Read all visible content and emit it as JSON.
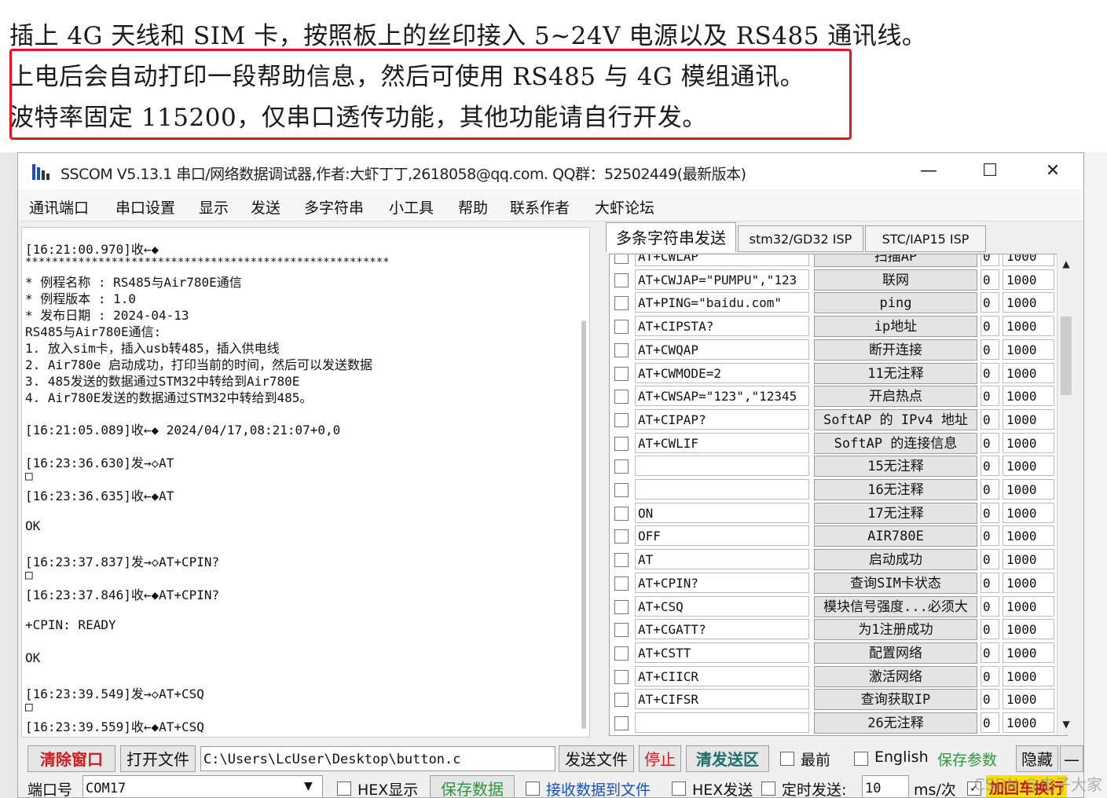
{
  "document": {
    "line1": "插上 4G 天线和 SIM 卡，按照板上的丝印接入 5~24V 电源以及 RS485 通讯线。",
    "line2": "上电后会自动打印一段帮助信息，然后可使用 RS485 与 4G 模组通讯。",
    "line3": "波特率固定 115200，仅串口透传功能，其他功能请自行开发。"
  },
  "window": {
    "title": "SSCOM V5.13.1 串口/网络数据调试器,作者:大虾丁丁,2618058@qq.com. QQ群：52502449(最新版本)",
    "minimize": "—",
    "maximize": "☐",
    "close": "✕"
  },
  "menu": [
    "通讯端口",
    "串口设置",
    "显示",
    "发送",
    "多字符串",
    "小工具",
    "帮助",
    "联系作者",
    "大虾论坛"
  ],
  "log": [
    "[16:21:00.970]收←◆",
    "*******************************************************",
    "*  例程名称    : RS485与Air780E通信",
    "*  例程版本    : 1.0",
    "*  发布日期    : 2024-04-13",
    "RS485与Air780E通信:",
    "1. 放入sim卡，插入usb转485，插入供电线",
    "2. Air780e 启动成功，打印当前的时间，然后可以发送数据",
    "3. 485发送的数据通过STM32中转给到Air780E",
    "4. Air780E发送的数据通过STM32中转给到485。",
    "[16:21:05.089]收←◆ 2024/04/17,08:21:07+0,0",
    "[16:23:36.630]发→◇AT",
    "□",
    "[16:23:36.635]收←◆AT",
    "OK",
    "[16:23:37.837]发→◇AT+CPIN?",
    "□",
    "[16:23:37.846]收←◆AT+CPIN?",
    "+CPIN: READY",
    "OK",
    "[16:23:39.549]发→◇AT+CSQ",
    "□",
    "[16:23:39.559]收←◆AT+CSQ"
  ],
  "tabs": [
    "多条字符串发送",
    "stm32/GD32 ISP",
    "STC/IAP15 ISP"
  ],
  "rows": [
    {
      "cmd": "AT+CWLAP",
      "btn": "扫描AP",
      "num": "0",
      "delay": "1000"
    },
    {
      "cmd": "AT+CWJAP=\"PUMPU\",\"123",
      "btn": "联网",
      "num": "0",
      "delay": "1000"
    },
    {
      "cmd": "AT+PING=\"baidu.com\"",
      "btn": "ping",
      "num": "0",
      "delay": "1000"
    },
    {
      "cmd": "AT+CIPSTA?",
      "btn": "ip地址",
      "num": "0",
      "delay": "1000"
    },
    {
      "cmd": "AT+CWQAP",
      "btn": "断开连接",
      "num": "0",
      "delay": "1000"
    },
    {
      "cmd": "AT+CWMODE=2",
      "btn": "11无注释",
      "num": "0",
      "delay": "1000"
    },
    {
      "cmd": "AT+CWSAP=\"123\",\"12345",
      "btn": "开启热点",
      "num": "0",
      "delay": "1000"
    },
    {
      "cmd": "AT+CIPAP?",
      "btn": "SoftAP 的 IPv4 地址",
      "num": "0",
      "delay": "1000"
    },
    {
      "cmd": "AT+CWLIF",
      "btn": "SoftAP 的连接信息",
      "num": "0",
      "delay": "1000"
    },
    {
      "cmd": "",
      "btn": "15无注释",
      "num": "0",
      "delay": "1000"
    },
    {
      "cmd": "",
      "btn": "16无注释",
      "num": "0",
      "delay": "1000"
    },
    {
      "cmd": "ON",
      "btn": "17无注释",
      "num": "0",
      "delay": "1000"
    },
    {
      "cmd": "OFF",
      "btn": "AIR780E",
      "num": "0",
      "delay": "1000"
    },
    {
      "cmd": "AT",
      "btn": "启动成功",
      "num": "0",
      "delay": "1000"
    },
    {
      "cmd": "AT+CPIN?",
      "btn": "查询SIM卡状态",
      "num": "0",
      "delay": "1000"
    },
    {
      "cmd": "AT+CSQ",
      "btn": "模块信号强度...必须大",
      "num": "0",
      "delay": "1000"
    },
    {
      "cmd": "AT+CGATT?",
      "btn": "为1注册成功",
      "num": "0",
      "delay": "1000"
    },
    {
      "cmd": "AT+CSTT",
      "btn": "配置网络",
      "num": "0",
      "delay": "1000"
    },
    {
      "cmd": "AT+CIICR",
      "btn": "激活网络",
      "num": "0",
      "delay": "1000"
    },
    {
      "cmd": "AT+CIFSR",
      "btn": "查询获取IP",
      "num": "0",
      "delay": "1000"
    },
    {
      "cmd": "",
      "btn": "26无注释",
      "num": "0",
      "delay": "1000"
    }
  ],
  "bottom": {
    "clear": "清除窗口",
    "open_file": "打开文件",
    "file_path": "C:\\Users\\LcUser\\Desktop\\button.c",
    "send_file": "发送文件",
    "stop": "停止",
    "clear_send": "清发送区",
    "topmost": "最前",
    "english": "English",
    "save_params": "保存参数",
    "hide": "隐藏",
    "minus": "—",
    "port_label": "端口号",
    "port_value": "COM17",
    "hex_display": "HEX显示",
    "save_data": "保存数据",
    "recv_to_file": "接收数据到文件",
    "hex_send": "HEX发送",
    "timed_send": "定时发送:",
    "interval": "10",
    "interval_unit": "ms/次",
    "add_crlf": "加回车换行"
  },
  "watermark": "CSDN @电子大家",
  "colors": {
    "accent_red": "#e8141c",
    "save_green": "#2a9a3a",
    "link_blue": "#1a4fc4"
  }
}
